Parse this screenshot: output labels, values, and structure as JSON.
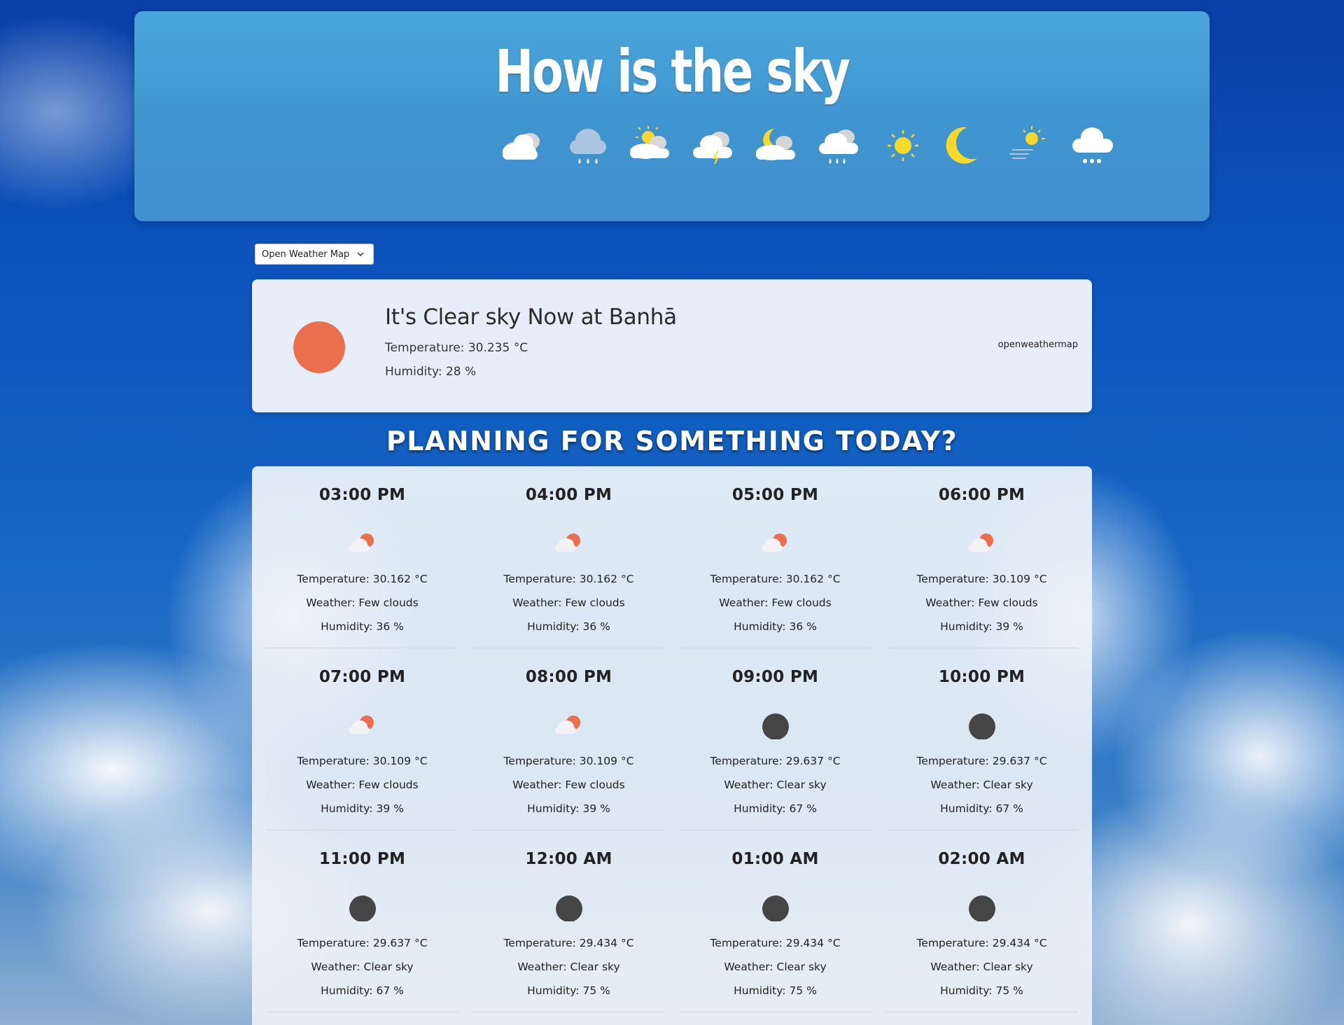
{
  "header": {
    "title": "How is the sky",
    "icons": [
      "cloudy-icon",
      "rain-icon",
      "partly-sunny-icon",
      "cloud-lightning-icon",
      "cloudy-night-icon",
      "cloud-rain-icon",
      "sun-icon",
      "moon-icon",
      "windy-sun-icon",
      "cloud-snow-icon"
    ]
  },
  "source_select": {
    "value": "Open Weather Map"
  },
  "current": {
    "title": "It's Clear sky Now at Banhā",
    "temperature": "Temperature: 30.235 °C",
    "humidity": "Humidity: 28 %",
    "source": "openweathermap",
    "icon": "clear-day",
    "sun_color": "#ea6f4d"
  },
  "forecast": {
    "title": "PLANNING FOR SOMETHING TODAY?",
    "slots": [
      {
        "time": "03:00 PM",
        "icon": "few-clouds-day",
        "temp": "Temperature: 30.162 °C",
        "weather": "Weather: Few clouds",
        "humidity": "Humidity: 36 %"
      },
      {
        "time": "04:00 PM",
        "icon": "few-clouds-day",
        "temp": "Temperature: 30.162 °C",
        "weather": "Weather: Few clouds",
        "humidity": "Humidity: 36 %"
      },
      {
        "time": "05:00 PM",
        "icon": "few-clouds-day",
        "temp": "Temperature: 30.162 °C",
        "weather": "Weather: Few clouds",
        "humidity": "Humidity: 36 %"
      },
      {
        "time": "06:00 PM",
        "icon": "few-clouds-day",
        "temp": "Temperature: 30.109 °C",
        "weather": "Weather: Few clouds",
        "humidity": "Humidity: 39 %"
      },
      {
        "time": "07:00 PM",
        "icon": "few-clouds-day",
        "temp": "Temperature: 30.109 °C",
        "weather": "Weather: Few clouds",
        "humidity": "Humidity: 39 %"
      },
      {
        "time": "08:00 PM",
        "icon": "few-clouds-day",
        "temp": "Temperature: 30.109 °C",
        "weather": "Weather: Few clouds",
        "humidity": "Humidity: 39 %"
      },
      {
        "time": "09:00 PM",
        "icon": "clear-night",
        "temp": "Temperature: 29.637 °C",
        "weather": "Weather: Clear sky",
        "humidity": "Humidity: 67 %"
      },
      {
        "time": "10:00 PM",
        "icon": "clear-night",
        "temp": "Temperature: 29.637 °C",
        "weather": "Weather: Clear sky",
        "humidity": "Humidity: 67 %"
      },
      {
        "time": "11:00 PM",
        "icon": "clear-night",
        "temp": "Temperature: 29.637 °C",
        "weather": "Weather: Clear sky",
        "humidity": "Humidity: 67 %"
      },
      {
        "time": "12:00 AM",
        "icon": "clear-night",
        "temp": "Temperature: 29.434 °C",
        "weather": "Weather: Clear sky",
        "humidity": "Humidity: 75 %"
      },
      {
        "time": "01:00 AM",
        "icon": "clear-night",
        "temp": "Temperature: 29.434 °C",
        "weather": "Weather: Clear sky",
        "humidity": "Humidity: 75 %"
      },
      {
        "time": "02:00 AM",
        "icon": "clear-night",
        "temp": "Temperature: 29.434 °C",
        "weather": "Weather: Clear sky",
        "humidity": "Humidity: 75 %"
      }
    ]
  },
  "colors": {
    "sun_orange": "#ea6f4d",
    "night_dark": "#454545",
    "icon_yellow": "#f6d92a",
    "header_blue": "#4aa6da"
  }
}
